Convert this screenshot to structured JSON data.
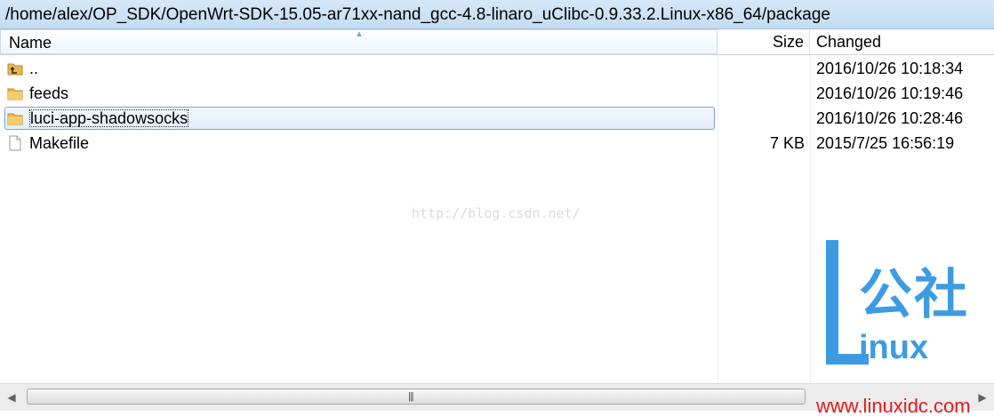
{
  "path_bar": {
    "path": "/home/alex/OP_SDK/OpenWrt-SDK-15.05-ar71xx-nand_gcc-4.8-linaro_uClibc-0.9.33.2.Linux-x86_64/package"
  },
  "columns": {
    "name": "Name",
    "size": "Size",
    "changed": "Changed"
  },
  "rows": [
    {
      "name": "..",
      "size": "",
      "changed": "2016/10/26 10:18:34",
      "icon": "parent-folder-icon"
    },
    {
      "name": "feeds",
      "size": "",
      "changed": "2016/10/26 10:19:46",
      "icon": "folder-icon"
    },
    {
      "name": "luci-app-shadowsocks",
      "size": "",
      "changed": "2016/10/26 10:28:46",
      "icon": "folder-icon",
      "selected": true
    },
    {
      "name": "Makefile",
      "size": "7 KB",
      "changed": "2015/7/25 16:56:19",
      "icon": "file-icon"
    }
  ],
  "watermark": {
    "url": "http://blog.csdn.net/",
    "logo_cn": "公社",
    "logo_latin": "inux",
    "site": "www.linuxidc.com"
  },
  "colors": {
    "folder": "#e8b84a",
    "selection_border": "#7da2ce",
    "logo": "#3d9be3",
    "site": "#e31b1b"
  }
}
